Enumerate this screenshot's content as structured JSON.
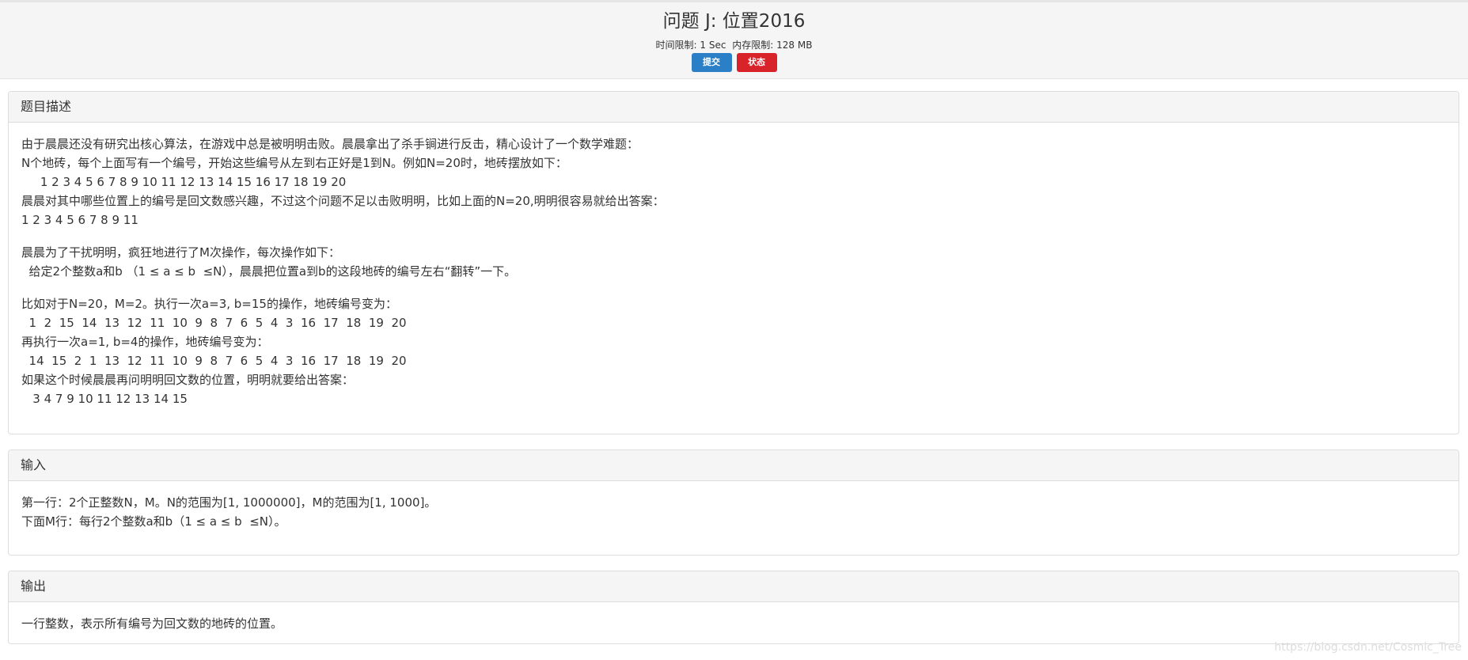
{
  "header": {
    "title": "问题 J: 位置2016",
    "time_limit": "时间限制: 1 Sec",
    "memory_limit": "内存限制: 128 MB",
    "submit_label": "提交",
    "status_label": "状态"
  },
  "description": {
    "heading": "题目描述",
    "lines": [
      "由于晨晨还没有研究出核心算法，在游戏中总是被明明击败。晨晨拿出了杀手锏进行反击，精心设计了一个数学难题：",
      "N个地砖，每个上面写有一个编号，开始这些编号从左到右正好是1到N。例如N=20时，地砖摆放如下：",
      "     1 2 3 4 5 6 7 8 9 10 11 12 13 14 15 16 17 18 19 20",
      "晨晨对其中哪些位置上的编号是回文数感兴趣，不过这个问题不足以击败明明，比如上面的N=20,明明很容易就给出答案：",
      "1 2 3 4 5 6 7 8 9 11"
    ],
    "lines2": [
      "晨晨为了干扰明明，疯狂地进行了M次操作，每次操作如下：",
      "  给定2个整数a和b （1 ≤ a ≤ b  ≤N），晨晨把位置a到b的这段地砖的编号左右“翻转”一下。"
    ],
    "lines3": [
      "比如对于N=20，M=2。执行一次a=3, b=15的操作，地砖编号变为：",
      "  1  2  15  14  13  12  11  10  9  8  7  6  5  4  3  16  17  18  19  20",
      "再执行一次a=1, b=4的操作，地砖编号变为：",
      "  14  15  2  1  13  12  11  10  9  8  7  6  5  4  3  16  17  18  19  20",
      "如果这个时候晨晨再问明明回文数的位置，明明就要给出答案：",
      "   3 4 7 9 10 11 12 13 14 15"
    ]
  },
  "input": {
    "heading": "输入",
    "lines": [
      "第一行：2个正整数N，M。N的范围为[1, 1000000]，M的范围为[1, 1000]。",
      "下面M行：每行2个整数a和b（1 ≤ a ≤ b  ≤N）。"
    ]
  },
  "output": {
    "heading": "输出",
    "lines": [
      "一行整数，表示所有编号为回文数的地砖的位置。"
    ]
  },
  "watermark": "https://blog.csdn.net/Cosmic_Tree"
}
